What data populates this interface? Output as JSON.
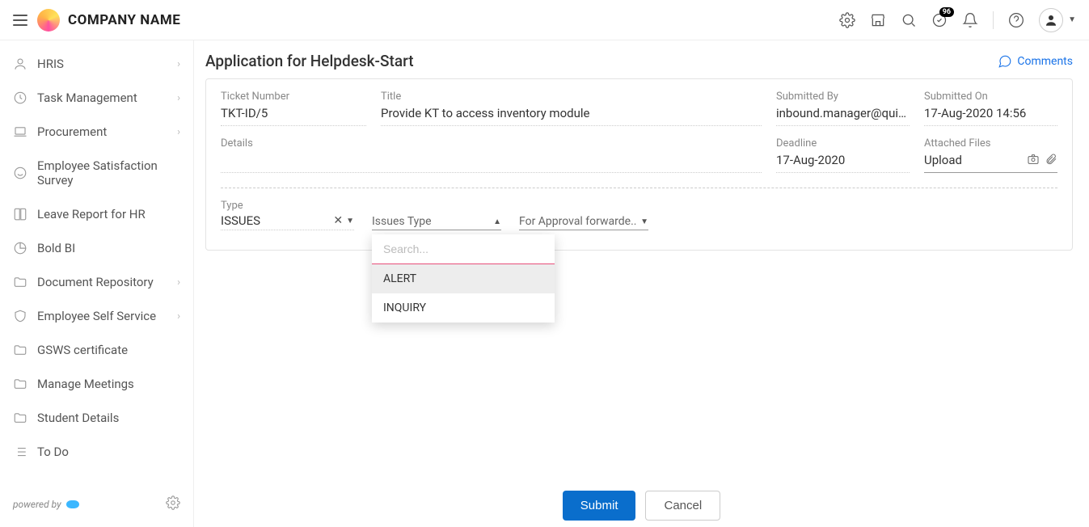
{
  "header": {
    "company_name": "COMPANY NAME",
    "badge_count": "96"
  },
  "sidebar": {
    "items": [
      {
        "label": "HRIS",
        "expandable": true
      },
      {
        "label": "Task Management",
        "expandable": true
      },
      {
        "label": "Procurement",
        "expandable": true
      },
      {
        "label": "Employee Satisfaction Survey",
        "expandable": false
      },
      {
        "label": "Leave Report for HR",
        "expandable": false
      },
      {
        "label": "Bold BI",
        "expandable": false
      },
      {
        "label": "Document Repository",
        "expandable": true
      },
      {
        "label": "Employee Self Service",
        "expandable": true
      },
      {
        "label": "GSWS certificate",
        "expandable": false
      },
      {
        "label": "Manage Meetings",
        "expandable": false
      },
      {
        "label": "Student Details",
        "expandable": false
      },
      {
        "label": "To Do",
        "expandable": false
      }
    ],
    "powered_by": "powered by"
  },
  "page": {
    "title": "Application for Helpdesk-Start",
    "comments_label": "Comments"
  },
  "fields": {
    "ticket_number": {
      "label": "Ticket Number",
      "value": "TKT-ID/5"
    },
    "title": {
      "label": "Title",
      "value": "Provide KT to access inventory module"
    },
    "submitted_by": {
      "label": "Submitted By",
      "value": "inbound.manager@qui…"
    },
    "submitted_on": {
      "label": "Submitted On",
      "value": "17-Aug-2020 14:56"
    },
    "details": {
      "label": "Details",
      "value": ""
    },
    "deadline": {
      "label": "Deadline",
      "value": "17-Aug-2020"
    },
    "attached_files": {
      "label": "Attached Files",
      "value": "Upload"
    }
  },
  "selects": {
    "type": {
      "label": "Type",
      "value": "ISSUES"
    },
    "issues_type": {
      "placeholder": "Issues Type",
      "search_placeholder": "Search...",
      "options": [
        "ALERT",
        "INQUIRY"
      ]
    },
    "for_approval": {
      "placeholder": "For Approval forwarde.."
    }
  },
  "actions": {
    "submit": "Submit",
    "cancel": "Cancel"
  }
}
